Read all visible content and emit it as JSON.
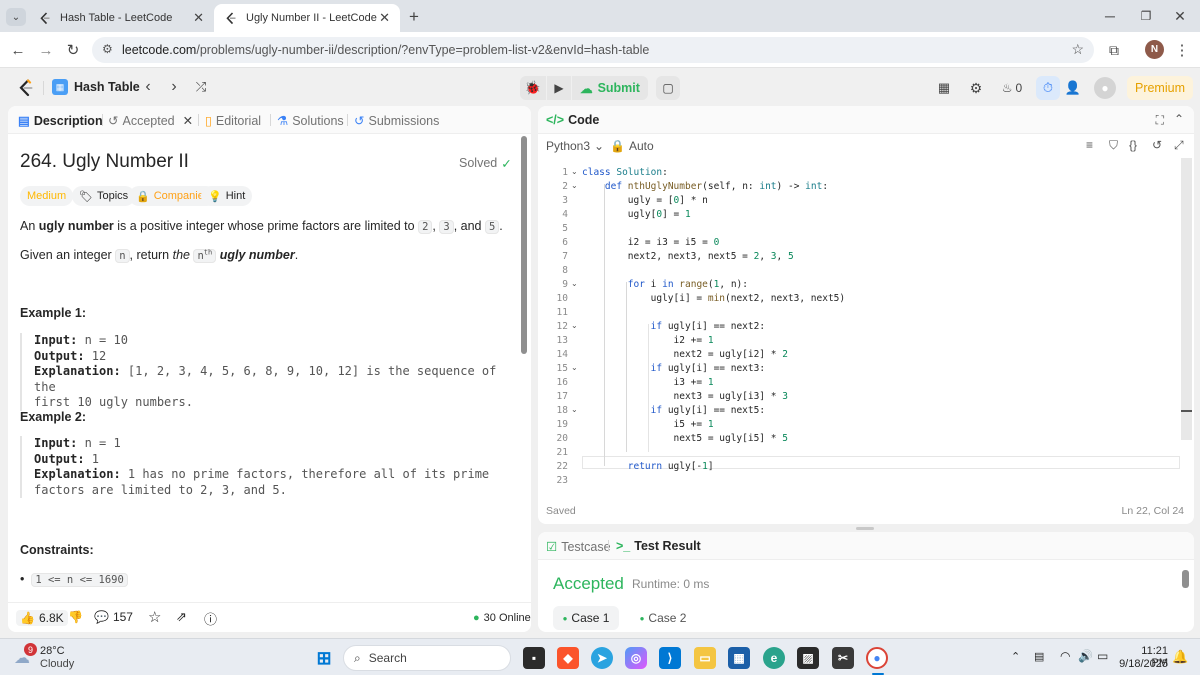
{
  "browser": {
    "tabs": [
      {
        "title": "Hash Table - LeetCode"
      },
      {
        "title": "Ugly Number II - LeetCode"
      }
    ],
    "url_host": "leetcode.com",
    "url_path": "/problems/ugly-number-ii/description/?envType=problem-list-v2&envId=hash-table",
    "profile_initial": "N"
  },
  "lcnav": {
    "list_name": "Hash Table",
    "submit_label": "Submit",
    "streak": "0",
    "premium_label": "Premium"
  },
  "left": {
    "tabs": [
      "Description",
      "Accepted",
      "Editorial",
      "Solutions",
      "Submissions"
    ],
    "title": "264. Ugly Number II",
    "solved_label": "Solved",
    "tags": [
      "Medium",
      "Topics",
      "Companies",
      "Hint"
    ],
    "desc1_pre": "An ",
    "desc1_bold": "ugly number",
    "desc1_mid": " is a positive integer whose prime factors are limited to ",
    "desc1_c1": "2",
    "desc1_c2": "3",
    "desc1_and": ", and ",
    "desc1_c3": "5",
    "desc1_end": ".",
    "desc2_pre": "Given an integer ",
    "desc2_code": "n",
    "desc2_mid": ", return ",
    "desc2_the": "the ",
    "desc2_nth": "n",
    "desc2_sup": "th",
    "desc2_bold": " ugly number",
    "desc2_end": ".",
    "example1_heading": "Example 1:",
    "example1": {
      "input_label": "Input:",
      "input": " n = 10",
      "output_label": "Output:",
      "output": " 12",
      "explanation_label": "Explanation:",
      "explanation_1": " [1, 2, 3, 4, 5, 6, 8, 9, 10, 12] is the sequence of the",
      "explanation_2": "first 10 ugly numbers."
    },
    "example2_heading": "Example 2:",
    "example2": {
      "input_label": "Input:",
      "input": " n = 1",
      "output_label": "Output:",
      "output": " 1",
      "explanation_label": "Explanation:",
      "explanation_1": " 1 has no prime factors, therefore all of its prime",
      "explanation_2": "factors are limited to 2, 3, and 5."
    },
    "constraints_heading": "Constraints:",
    "constraint_1": "1 <= n <= 1690",
    "likes": "6.8K",
    "comments": "157",
    "online": "30 Online"
  },
  "code": {
    "header": "Code",
    "language": "Python3",
    "mode": "Auto",
    "saved": "Saved",
    "cursor": "Ln 22, Col 24"
  },
  "result": {
    "tabs": [
      "Testcase",
      "Test Result"
    ],
    "status": "Accepted",
    "runtime": "Runtime: 0 ms",
    "cases": [
      "Case 1",
      "Case 2"
    ]
  },
  "taskbar": {
    "weather_temp": "28°C",
    "weather_desc": "Cloudy",
    "weather_badge": "9",
    "search_label": "Search",
    "time": "11:21 PM",
    "date": "9/18/2025"
  },
  "colors": {
    "accent_green": "#2db55d",
    "medium_orange": "#ffb800",
    "premium_bg": "#fdf3dc",
    "premium_text": "#e6a100"
  }
}
